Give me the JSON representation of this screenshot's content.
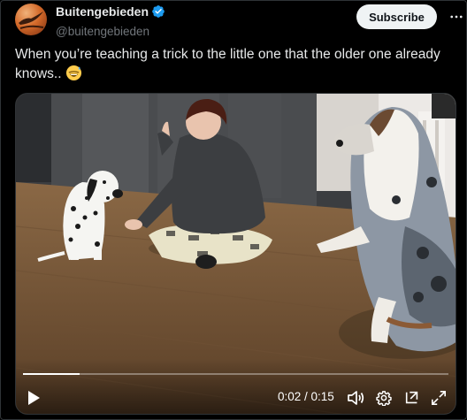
{
  "author": {
    "display_name": "Buitengebieden",
    "handle": "@buitengebieden",
    "verified": true
  },
  "actions": {
    "subscribe_label": "Subscribe",
    "more_icon": "more-icon"
  },
  "tweet": {
    "text": "When you’re teaching a trick to the little one that the older one already knows..",
    "emoji": "grinning-face-with-sweat"
  },
  "video": {
    "current_time": "0:02",
    "duration": "0:15",
    "time_display": "0:02 / 0:15",
    "progress": 0.133,
    "controls": {
      "play": "play-icon",
      "volume": "volume-icon",
      "settings": "gear-icon",
      "popout": "popout-icon",
      "fullscreen": "fullscreen-icon"
    }
  },
  "colors": {
    "background": "#000000",
    "text_primary": "#e7e9ea",
    "text_secondary": "#71767b",
    "verified_blue": "#1d9bf0",
    "subscribe_bg": "#eff3f4"
  }
}
